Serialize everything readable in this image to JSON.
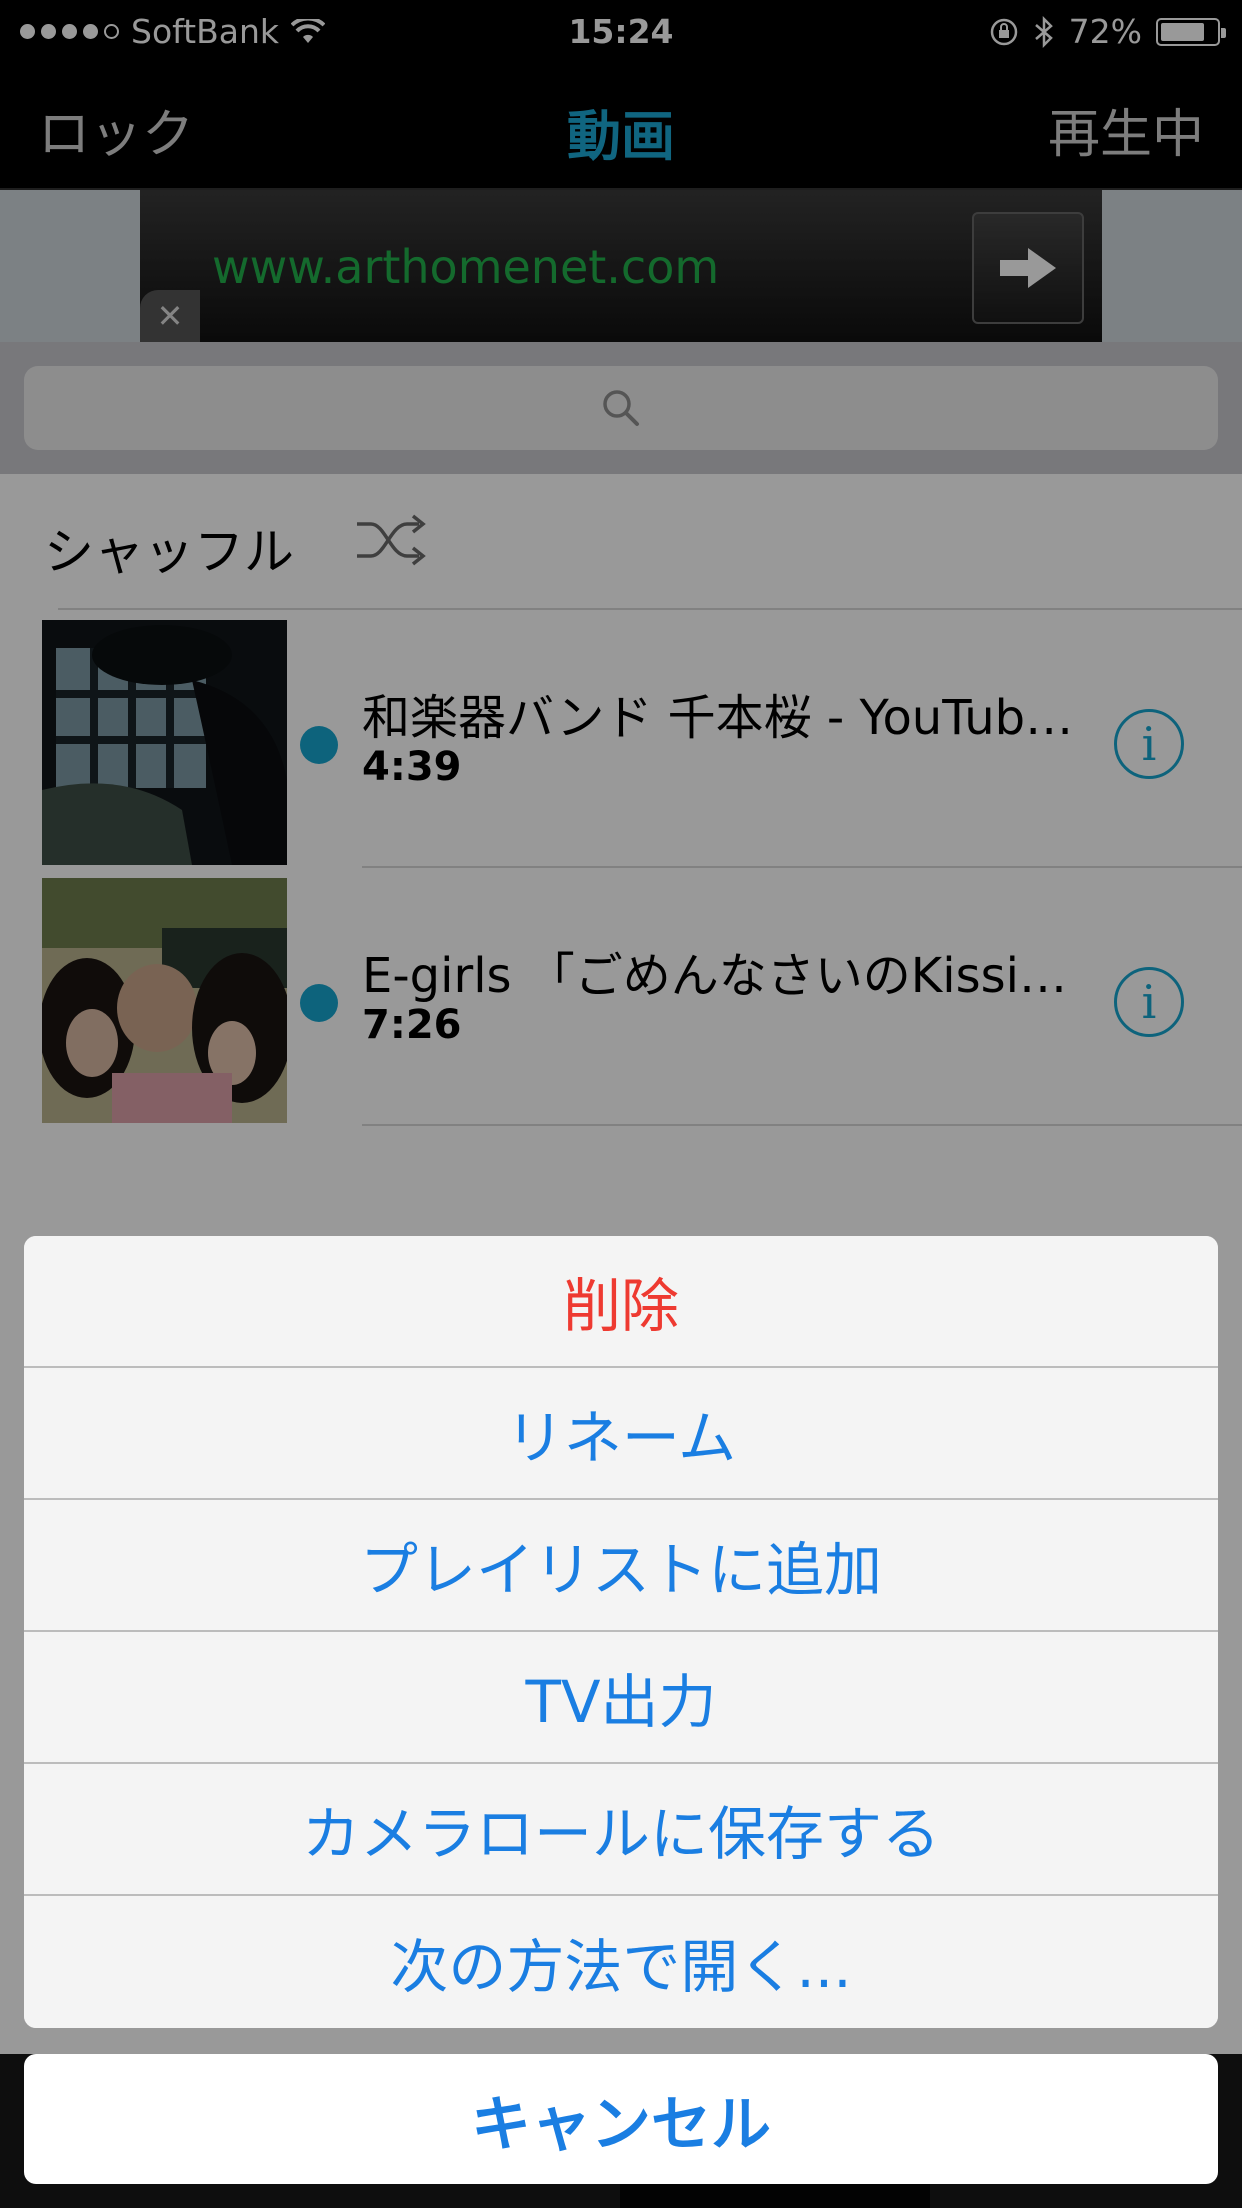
{
  "status_bar": {
    "carrier": "SoftBank",
    "time": "15:24",
    "battery_text": "72%",
    "battery_level": 0.72
  },
  "nav": {
    "left": "ロック",
    "title": "動画",
    "right": "再生中"
  },
  "ad": {
    "url": "www.arthomenet.com"
  },
  "search": {
    "placeholder": ""
  },
  "shuffle": {
    "label": "シャッフル"
  },
  "videos": [
    {
      "title": "和楽器バンド  千本桜 - YouTub…",
      "duration": "4:39"
    },
    {
      "title": "E-girls 「ごめんなさいのKissi…",
      "duration": "7:26"
    }
  ],
  "action_sheet": {
    "delete": "削除",
    "rename": "リネーム",
    "add_playlist": "プレイリストに追加",
    "tv_out": "TV出力",
    "save_roll": "カメラロールに保存する",
    "open_with": "次の方法で開く...",
    "cancel": "キャンセル"
  },
  "colors": {
    "accent": "#1ca9d6",
    "action_blue": "#1a7ee2",
    "destructive": "#ee3a31"
  }
}
